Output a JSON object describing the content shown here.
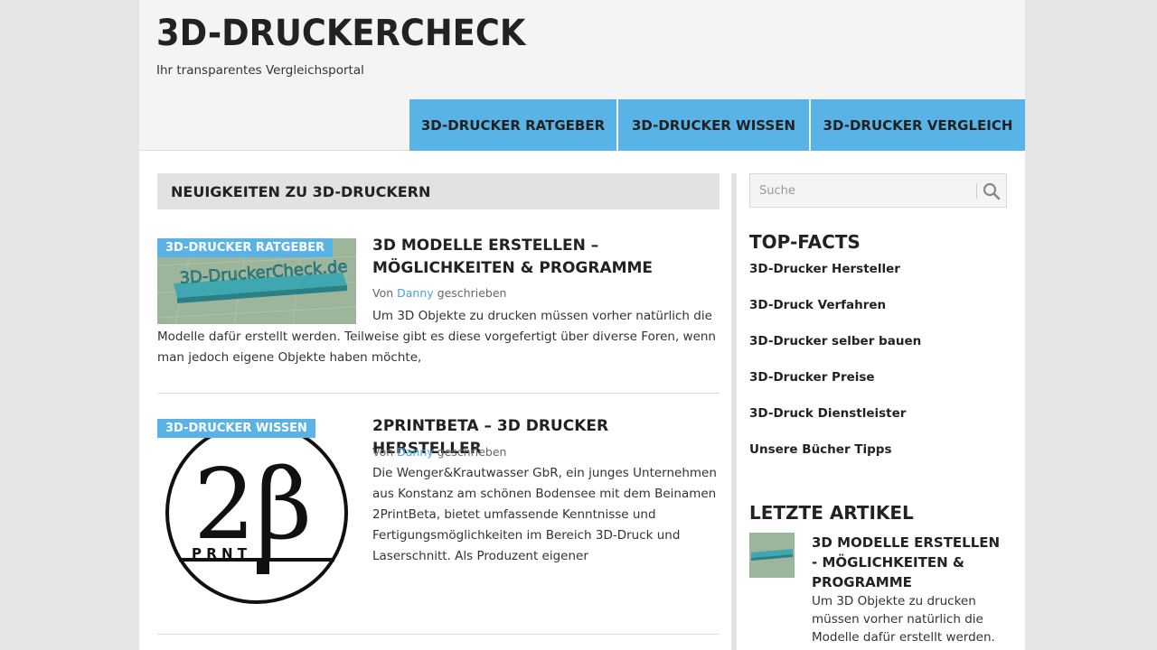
{
  "site": {
    "title": "3D-DRUCKERCHECK",
    "tagline": "Ihr transparentes Vergleichsportal"
  },
  "nav": {
    "items": [
      {
        "label": "3D-DRUCKER RATGEBER"
      },
      {
        "label": "3D-DRUCKER WISSEN"
      },
      {
        "label": "3D-DRUCKER VERGLEICH"
      }
    ]
  },
  "main": {
    "section_title": "NEUIGKEITEN ZU 3D-DRUCKERN",
    "posts": [
      {
        "category": "3D-DRUCKER RATGEBER",
        "thumb_text": "3D-DruckerCheck.de",
        "title": "3D MODELLE ERSTELLEN – MÖGLICHKEITEN & PROGRAMME",
        "meta_prefix": "Von",
        "author": "Danny",
        "meta_suffix": "geschrieben",
        "excerpt_part1": "Um 3D Objekte zu drucken müssen vorher natürlich die",
        "excerpt_part2": "Modelle dafür erstellt werden. Teilweise gibt es diese vorgefertigt über diverse Foren, wenn man jedoch eigene Objekte haben möchte,"
      },
      {
        "category": "3D-DRUCKER WISSEN",
        "logo_text": "2β",
        "logo_subtext": "P R N T",
        "title": "2PRINTBETA – 3D DRUCKER HERSTELLER",
        "meta_prefix": "Von",
        "author": "Danny",
        "meta_suffix": "geschrieben",
        "excerpt": "Die Wenger&Krautwasser GbR, ein junges Unternehmen aus Konstanz am schönen Bodensee mit dem Beinamen 2PrintBeta, bietet umfassende Kenntnisse und Fertigungsmöglichkeiten im Bereich 3D-Druck und Laserschnitt. Als Produzent eigener"
      }
    ]
  },
  "sidebar": {
    "search_placeholder": "Suche",
    "facts_title": "TOP-FACTS",
    "facts": [
      "3D-Drucker Hersteller",
      "3D-Druck Verfahren",
      "3D-Drucker selber bauen",
      "3D-Drucker Preise",
      "3D-Druck Dienstleister",
      "Unsere Bücher Tipps"
    ],
    "articles_title": "LETZTE ARTIKEL",
    "latest_article": {
      "title": "3D MODELLE ERSTELLEN - MÖGLICHKEITEN & PROGRAMME",
      "excerpt": "Um 3D Objekte zu drucken müssen vorher natürlich die Modelle dafür erstellt werden."
    }
  },
  "colors": {
    "accent": "#5ab3e6",
    "link": "#4aa3df",
    "header_bg": "#f4f4f4",
    "page_bg": "#e5e5e5"
  }
}
